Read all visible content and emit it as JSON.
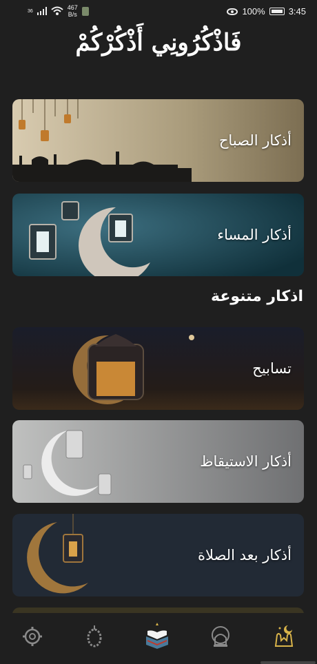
{
  "status_bar": {
    "network": "36",
    "speed_value": "467",
    "speed_unit": "B/s",
    "battery": "100%",
    "time": "3:45"
  },
  "app": {
    "title": "فَاذْكُرُونِي أَذْكُرْكُمْ"
  },
  "cards": [
    {
      "label": "أذكار الصباح"
    },
    {
      "label": "أذكار المساء"
    }
  ],
  "section": {
    "title": "اذكار متنوعة"
  },
  "varied_cards": [
    {
      "label": "تسابيح"
    },
    {
      "label": "أذكار الاستيقاظ"
    },
    {
      "label": "أذكار بعد الصلاة"
    }
  ],
  "nav": {
    "items": [
      "settings-icon",
      "prayer-beads-icon",
      "quran-icon",
      "mosque-icon",
      "dua-hands-icon"
    ],
    "active_color": "#d9b44a",
    "inactive_color": "#8a8a8a"
  },
  "colors": {
    "background": "#1f1f1f",
    "accent": "#d9b44a"
  }
}
